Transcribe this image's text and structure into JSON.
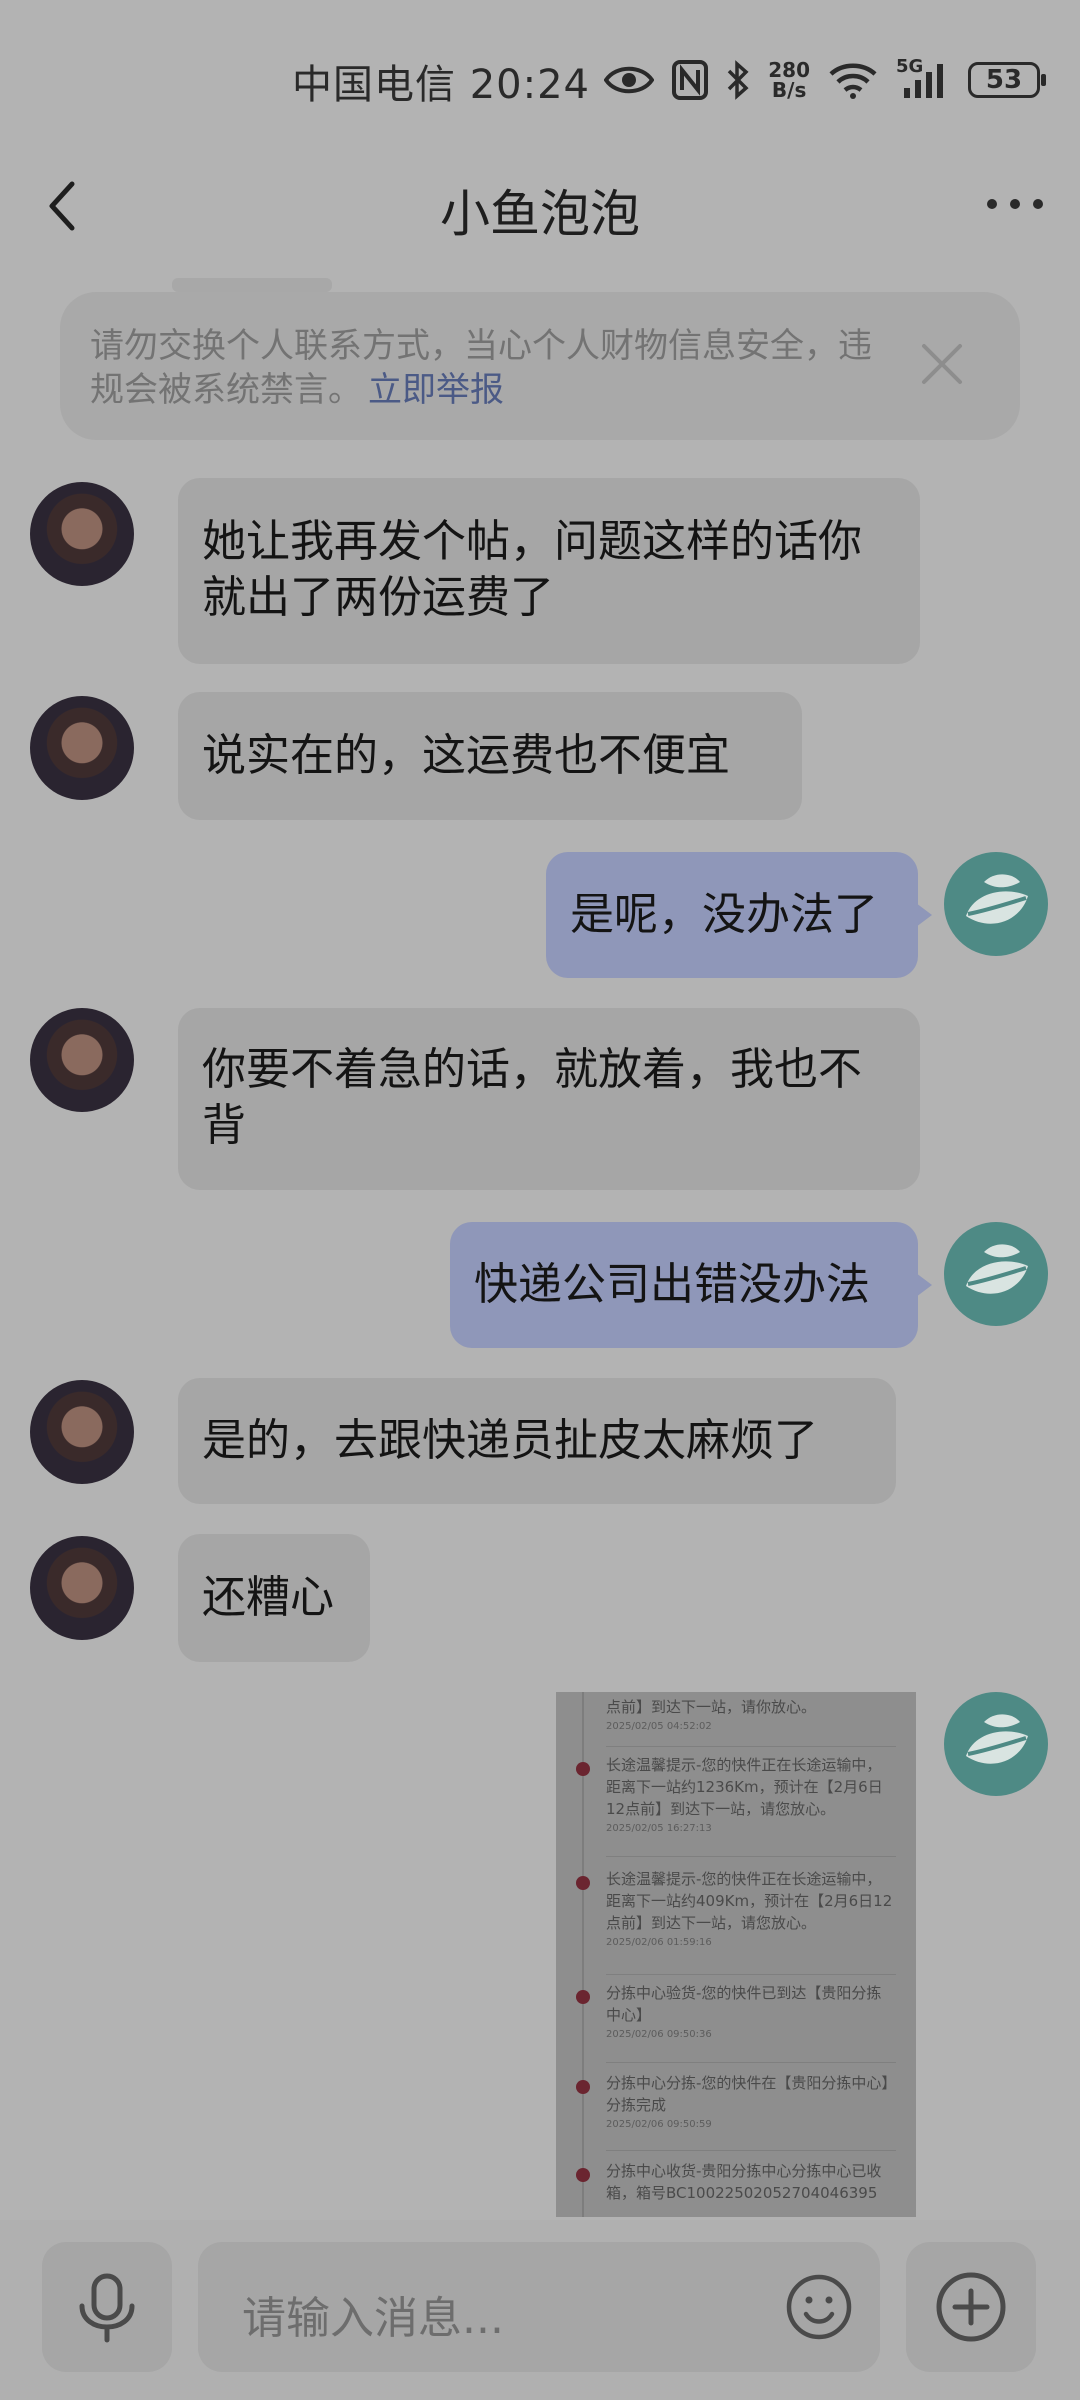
{
  "status_bar": {
    "carrier_time": "中国电信 20:24",
    "net_speed_value": "280",
    "net_speed_unit": "B/s",
    "network_label": "5G",
    "battery": "53"
  },
  "header": {
    "title": "小鱼泡泡"
  },
  "notice": {
    "text": "请勿交换个人联系方式，当心个人财物信息安全，违规会被系统禁言。",
    "report_link": "立即举报"
  },
  "messages": [
    {
      "side": "in",
      "text": "她让我再发个帖，问题这样的话你就出了两份运费了"
    },
    {
      "side": "in",
      "text": "说实在的，这运费也不便宜"
    },
    {
      "side": "out",
      "text": "是呢，没办法了"
    },
    {
      "side": "in",
      "text": "你要不着急的话，就放着，我也不背"
    },
    {
      "side": "out",
      "text": "快递公司出错没办法"
    },
    {
      "side": "in",
      "text": "是的，去跟快递员扯皮太麻烦了"
    },
    {
      "side": "in",
      "text": "还糟心"
    }
  ],
  "shared_image": {
    "entries": [
      {
        "text": "点前】到达下一站，请你放心。",
        "time": "2025/02/05 04:52:02"
      },
      {
        "text": "长途温馨提示-您的快件正在长途运输中，距离下一站约1236Km，预计在【2月6日12点前】到达下一站，请您放心。",
        "time": "2025/02/05 16:27:13"
      },
      {
        "text": "长途温馨提示-您的快件正在长途运输中，距离下一站约409Km，预计在【2月6日12点前】到达下一站，请您放心。",
        "time": "2025/02/06 01:59:16"
      },
      {
        "text": "分拣中心验货-您的快件已到达【贵阳分拣中心】",
        "time": "2025/02/06 09:50:36"
      },
      {
        "text": "分拣中心分拣-您的快件在【贵阳分拣中心】分拣完成",
        "time": "2025/02/06 09:50:59"
      },
      {
        "text": "分拣中心收货-贵阳分拣中心分拣中心已收箱，箱号BC10022502052704046395",
        "time": ""
      }
    ]
  },
  "input": {
    "placeholder": "请输入消息..."
  }
}
